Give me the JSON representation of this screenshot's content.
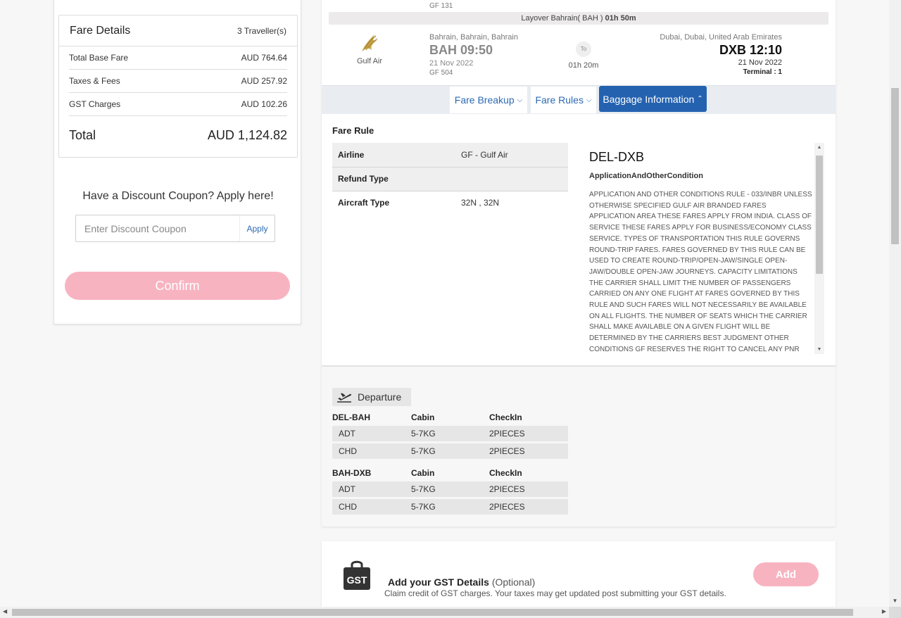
{
  "fare_details": {
    "title": "Fare Details",
    "travellers": "3 Traveller(s)",
    "rows": [
      {
        "label": "Total Base Fare",
        "value": "AUD 764.64"
      },
      {
        "label": "Taxes & Fees",
        "value": "AUD 257.92"
      },
      {
        "label": "GST Charges",
        "value": "AUD 102.26"
      }
    ],
    "total_label": "Total",
    "total_value": "AUD 1,124.82"
  },
  "coupon": {
    "title": "Have a Discount Coupon? Apply here!",
    "placeholder": "Enter Discount Coupon",
    "apply_label": "Apply"
  },
  "confirm_label": "Confirm",
  "flight": {
    "prev_flight_no": "GF 131",
    "layover_prefix": "Layover Bahrain( BAH )",
    "layover_duration": "01h 50m",
    "airline_name": "Gulf Air",
    "dep_city": "Bahrain, Bahrain, Bahrain",
    "dep_time": "BAH 09:50",
    "dep_date": "21 Nov 2022",
    "flight_no": "GF 504",
    "to_label": "To",
    "duration": "01h 20m",
    "arr_city": "Dubai, Dubai, United Arab Emirates",
    "arr_time": "DXB 12:10",
    "arr_date": "21 Nov 2022",
    "terminal": "Terminal : 1"
  },
  "tabs": [
    {
      "label": "Fare Breakup",
      "icon": "chevron-down-icon"
    },
    {
      "label": "Fare Rules",
      "icon": "chevron-down-icon"
    },
    {
      "label": "Baggage Information",
      "icon": "chevron-up-icon"
    }
  ],
  "fare_rule": {
    "title": "Fare Rule",
    "rows": [
      {
        "key": "Airline",
        "value": "GF - Gulf Air"
      },
      {
        "key": "Refund Type",
        "value": ""
      },
      {
        "key": "Aircraft Type",
        "value": "32N , 32N"
      }
    ],
    "route": "DEL-DXB",
    "condition_title": "ApplicationAndOtherCondition",
    "condition_text": "APPLICATION AND OTHER CONDITIONS RULE - 033/INBR UNLESS OTHERWISE SPECIFIED GULF AIR BRANDED FARES APPLICATION AREA THESE FARES APPLY FROM INDIA. CLASS OF SERVICE THESE FARES APPLY FOR BUSINESS/ECONOMY CLASS SERVICE. TYPES OF TRANSPORTATION THIS RULE GOVERNS ROUND-TRIP FARES. FARES GOVERNED BY THIS RULE CAN BE USED TO CREATE ROUND-TRIP/OPEN-JAW/SINGLE OPEN-JAW/DOUBLE OPEN-JAW JOURNEYS. CAPACITY LIMITATIONS THE CARRIER SHALL LIMIT THE NUMBER OF PASSENGERS CARRIED ON ANY ONE FLIGHT AT FARES GOVERNED BY THIS RULE AND SUCH FARES WILL NOT NECESSARILY BE AVAILABLE ON ALL FLIGHTS. THE NUMBER OF SEATS WHICH THE CARRIER SHALL MAKE AVAILABLE ON A GIVEN FLIGHT WILL BE DETERMINED BY THE CARRIERS BEST JUDGMENT OTHER CONDITIONS GF RESERVES THE RIGHT TO CANCEL ANY PNR"
  },
  "baggage": {
    "departure_label": "Departure",
    "col_cabin": "Cabin",
    "col_checkin": "CheckIn",
    "segments": [
      {
        "route": "DEL-BAH",
        "rows": [
          {
            "pax": "ADT",
            "cabin": "5-7KG",
            "checkin": "2PIECES"
          },
          {
            "pax": "CHD",
            "cabin": "5-7KG",
            "checkin": "2PIECES"
          }
        ]
      },
      {
        "route": "BAH-DXB",
        "rows": [
          {
            "pax": "ADT",
            "cabin": "5-7KG",
            "checkin": "2PIECES"
          },
          {
            "pax": "CHD",
            "cabin": "5-7KG",
            "checkin": "2PIECES"
          }
        ]
      }
    ]
  },
  "gst": {
    "icon_text": "GST",
    "title": "Add your GST Details",
    "optional": "(Optional)",
    "subtitle": "Claim credit of GST charges. Your taxes may get updated post submitting your GST details.",
    "add_label": "Add"
  },
  "colors": {
    "primary_blue": "#2462b0",
    "confirm_pink": "#f8b3c1"
  }
}
